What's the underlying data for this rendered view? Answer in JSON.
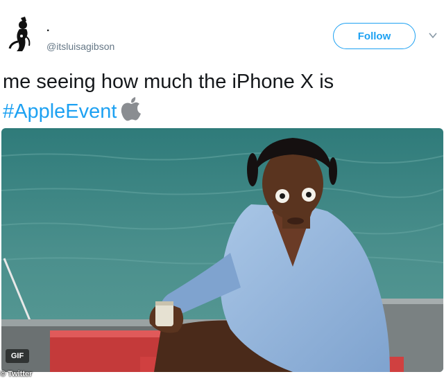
{
  "user": {
    "display_name": ".",
    "handle": "@itsluisagibson",
    "avatar_icon": "fox-avatar-icon"
  },
  "actions": {
    "follow_label": "Follow",
    "menu_icon": "chevron-down-icon"
  },
  "tweet": {
    "text": "me seeing how much the iPhone X is",
    "hashtag": "#AppleEvent",
    "emoji_icon": "apple-logo-icon"
  },
  "media": {
    "type_badge": "GIF",
    "credit": "© Twitter",
    "description_icon": "gif-frame"
  },
  "colors": {
    "accent": "#1da1f2",
    "text": "#14171a",
    "secondary": "#657786"
  }
}
